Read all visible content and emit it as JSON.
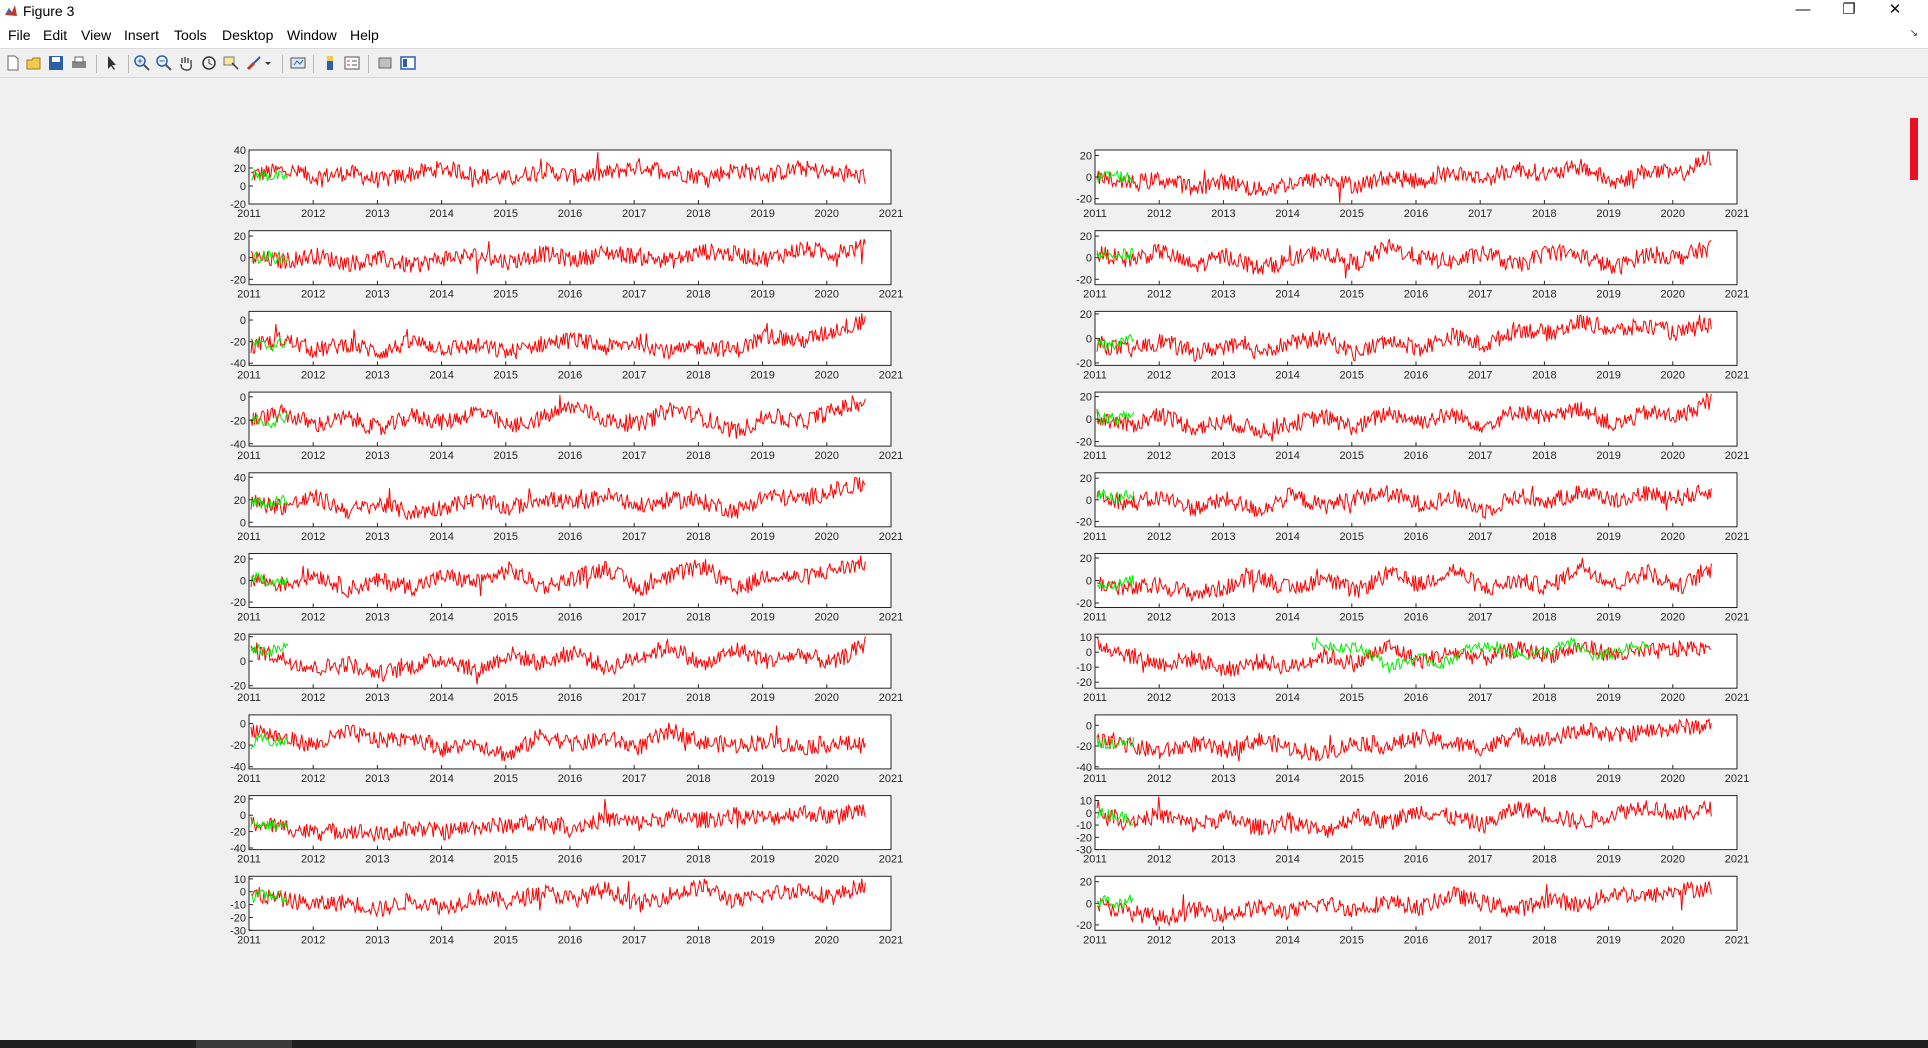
{
  "window": {
    "title": "Figure 3",
    "minimize_glyph": "—",
    "maximize_glyph": "❐",
    "close_glyph": "✕"
  },
  "menu": [
    "File",
    "Edit",
    "View",
    "Insert",
    "Tools",
    "Desktop",
    "Window",
    "Help"
  ],
  "toolbar_icons": [
    "new-figure-icon",
    "open-file-icon",
    "save-icon",
    "print-icon",
    "edit-plot-arrow-icon",
    "zoom-in-icon",
    "zoom-out-icon",
    "pan-hand-icon",
    "rotate-3d-icon",
    "data-cursor-icon",
    "brush-icon",
    "link-plot-icon",
    "colorbar-icon",
    "legend-icon",
    "hide-plot-tools-icon",
    "show-plot-tools-icon"
  ],
  "colors": {
    "series_primary": "#ff0000",
    "series_highlight": "#00ee00",
    "axes_bg": "#ffffff",
    "figure_bg": "#f0f0f0"
  },
  "chart_data": [
    {
      "type": "line",
      "position": "left-1",
      "x_ticks": [
        "2011",
        "2012",
        "2013",
        "2014",
        "2015",
        "2016",
        "2017",
        "2018",
        "2019",
        "2020",
        "2021"
      ],
      "y_ticks": [
        "40",
        "20",
        "0",
        "-20"
      ],
      "ylim": [
        -20,
        40
      ],
      "series": [
        {
          "color": "red",
          "values": [
            12,
            18,
            10,
            15,
            6,
            14,
            20,
            12,
            8,
            18,
            10,
            14,
            22,
            16,
            10,
            18,
            12,
            20,
            14,
            10
          ]
        },
        {
          "color": "green",
          "values": [
            12,
            11,
            10
          ]
        }
      ]
    },
    {
      "type": "line",
      "position": "left-2",
      "x_ticks": [
        "2011",
        "2012",
        "2013",
        "2014",
        "2015",
        "2016",
        "2017",
        "2018",
        "2019",
        "2020",
        "2021"
      ],
      "y_ticks": [
        "20",
        "0",
        "-20"
      ],
      "ylim": [
        -25,
        25
      ],
      "series": [
        {
          "color": "red",
          "values": [
            0,
            -3,
            2,
            -5,
            -1,
            -8,
            0,
            2,
            -4,
            4,
            -2,
            5,
            1,
            -3,
            6,
            3,
            -1,
            8,
            4,
            10
          ]
        },
        {
          "color": "green",
          "values": [
            0,
            1,
            -1
          ]
        }
      ]
    },
    {
      "type": "line",
      "position": "left-3",
      "x_ticks": [
        "2011",
        "2012",
        "2013",
        "2014",
        "2015",
        "2016",
        "2017",
        "2018",
        "2019",
        "2020",
        "2021"
      ],
      "y_ticks": [
        "0",
        "-20",
        "-40"
      ],
      "ylim": [
        -42,
        8
      ],
      "series": [
        {
          "color": "red",
          "values": [
            -25,
            -18,
            -28,
            -22,
            -30,
            -20,
            -26,
            -24,
            -30,
            -22,
            -18,
            -26,
            -20,
            -30,
            -24,
            -28,
            -14,
            -20,
            -10,
            0
          ]
        },
        {
          "color": "green",
          "values": [
            -22,
            -24,
            -20
          ]
        }
      ]
    },
    {
      "type": "line",
      "position": "left-4",
      "x_ticks": [
        "2011",
        "2012",
        "2013",
        "2014",
        "2015",
        "2016",
        "2017",
        "2018",
        "2019",
        "2020",
        "2021"
      ],
      "y_ticks": [
        "0",
        "-20",
        "-40"
      ],
      "ylim": [
        -42,
        4
      ],
      "series": [
        {
          "color": "red",
          "values": [
            -20,
            -14,
            -24,
            -18,
            -28,
            -16,
            -22,
            -12,
            -26,
            -18,
            -8,
            -20,
            -24,
            -10,
            -18,
            -30,
            -16,
            -22,
            -12,
            -4
          ]
        },
        {
          "color": "green",
          "values": [
            -18,
            -22,
            -16
          ]
        }
      ]
    },
    {
      "type": "line",
      "position": "left-5",
      "x_ticks": [
        "2011",
        "2012",
        "2013",
        "2014",
        "2015",
        "2016",
        "2017",
        "2018",
        "2019",
        "2020",
        "2021"
      ],
      "y_ticks": [
        "40",
        "20",
        "0"
      ],
      "ylim": [
        -4,
        44
      ],
      "series": [
        {
          "color": "red",
          "values": [
            18,
            14,
            22,
            10,
            16,
            8,
            14,
            20,
            12,
            22,
            16,
            24,
            14,
            20,
            18,
            10,
            24,
            20,
            28,
            34
          ]
        },
        {
          "color": "green",
          "values": [
            18,
            16,
            20
          ]
        }
      ]
    },
    {
      "type": "line",
      "position": "left-6",
      "x_ticks": [
        "2011",
        "2012",
        "2013",
        "2014",
        "2015",
        "2016",
        "2017",
        "2018",
        "2019",
        "2020",
        "2021"
      ],
      "y_ticks": [
        "20",
        "0",
        "-20"
      ],
      "ylim": [
        -25,
        25
      ],
      "series": [
        {
          "color": "red",
          "values": [
            2,
            -4,
            6,
            -8,
            0,
            -6,
            4,
            -2,
            10,
            -6,
            2,
            12,
            -8,
            4,
            14,
            -10,
            6,
            2,
            10,
            16
          ]
        },
        {
          "color": "green",
          "values": [
            2,
            0,
            -2
          ]
        }
      ]
    },
    {
      "type": "line",
      "position": "left-7",
      "x_ticks": [
        "2011",
        "2012",
        "2013",
        "2014",
        "2015",
        "2016",
        "2017",
        "2018",
        "2019",
        "2020",
        "2021"
      ],
      "y_ticks": [
        "20",
        "0",
        "-20"
      ],
      "ylim": [
        -22,
        22
      ],
      "series": [
        {
          "color": "red",
          "values": [
            10,
            2,
            -6,
            -2,
            -10,
            -4,
            2,
            -8,
            6,
            -2,
            8,
            -6,
            4,
            12,
            -4,
            10,
            0,
            6,
            -2,
            14
          ]
        },
        {
          "color": "green",
          "values": [
            10,
            8,
            12
          ]
        }
      ]
    },
    {
      "type": "line",
      "position": "left-8",
      "x_ticks": [
        "2011",
        "2012",
        "2013",
        "2014",
        "2015",
        "2016",
        "2017",
        "2018",
        "2019",
        "2020",
        "2021"
      ],
      "y_ticks": [
        "0",
        "-20",
        "-40"
      ],
      "ylim": [
        -42,
        8
      ],
      "series": [
        {
          "color": "red",
          "values": [
            -4,
            -14,
            -20,
            -8,
            -16,
            -12,
            -24,
            -18,
            -30,
            -10,
            -20,
            -14,
            -22,
            -6,
            -18,
            -20,
            -16,
            -22,
            -18,
            -20
          ]
        },
        {
          "color": "green",
          "values": [
            -20,
            -14,
            -18,
            -16
          ]
        }
      ]
    },
    {
      "type": "line",
      "position": "left-9",
      "x_ticks": [
        "2011",
        "2012",
        "2013",
        "2014",
        "2015",
        "2016",
        "2017",
        "2018",
        "2019",
        "2020",
        "2021"
      ],
      "y_ticks": [
        "20",
        "0",
        "-20",
        "-40"
      ],
      "ylim": [
        -42,
        24
      ],
      "series": [
        {
          "color": "red",
          "values": [
            -10,
            -14,
            -22,
            -18,
            -24,
            -16,
            -20,
            -14,
            -12,
            -8,
            -14,
            -4,
            -10,
            -2,
            -6,
            0,
            -4,
            4,
            -2,
            8
          ]
        },
        {
          "color": "green",
          "values": [
            -10,
            -12,
            -14
          ]
        }
      ]
    },
    {
      "type": "line",
      "position": "left-10",
      "x_ticks": [
        "2011",
        "2012",
        "2013",
        "2014",
        "2015",
        "2016",
        "2017",
        "2018",
        "2019",
        "2020",
        "2021"
      ],
      "y_ticks": [
        "10",
        "0",
        "-10",
        "-20",
        "-30"
      ],
      "ylim": [
        -30,
        12
      ],
      "series": [
        {
          "color": "red",
          "values": [
            -2,
            -6,
            -10,
            -8,
            -14,
            -6,
            -12,
            -4,
            -8,
            0,
            -6,
            2,
            -10,
            -2,
            4,
            -8,
            -2,
            2,
            -4,
            6
          ]
        },
        {
          "color": "green",
          "values": [
            -4,
            -2,
            -6
          ]
        }
      ]
    },
    {
      "type": "line",
      "position": "right-1",
      "x_ticks": [
        "2011",
        "2012",
        "2013",
        "2014",
        "2015",
        "2016",
        "2017",
        "2018",
        "2019",
        "2020",
        "2021"
      ],
      "y_ticks": [
        "20",
        "0",
        "-20"
      ],
      "ylim": [
        -25,
        25
      ],
      "series": [
        {
          "color": "red",
          "values": [
            0,
            -6,
            -2,
            -10,
            -4,
            -12,
            -6,
            -2,
            -8,
            0,
            -4,
            4,
            -2,
            8,
            2,
            10,
            -6,
            6,
            2,
            18
          ]
        },
        {
          "color": "green",
          "values": [
            0,
            2,
            -2
          ]
        }
      ]
    },
    {
      "type": "line",
      "position": "right-2",
      "x_ticks": [
        "2011",
        "2012",
        "2013",
        "2014",
        "2015",
        "2016",
        "2017",
        "2018",
        "2019",
        "2020",
        "2021"
      ],
      "y_ticks": [
        "20",
        "0",
        "-20"
      ],
      "ylim": [
        -25,
        25
      ],
      "series": [
        {
          "color": "red",
          "values": [
            4,
            -2,
            6,
            -8,
            2,
            -10,
            -2,
            6,
            -6,
            10,
            0,
            -4,
            4,
            -8,
            6,
            2,
            -10,
            4,
            0,
            10
          ]
        },
        {
          "color": "green",
          "values": [
            4,
            0,
            6
          ]
        }
      ]
    },
    {
      "type": "line",
      "position": "right-3",
      "x_ticks": [
        "2011",
        "2012",
        "2013",
        "2014",
        "2015",
        "2016",
        "2017",
        "2018",
        "2019",
        "2020",
        "2021"
      ],
      "y_ticks": [
        "20",
        "0",
        "-20"
      ],
      "ylim": [
        -22,
        22
      ],
      "series": [
        {
          "color": "red",
          "values": [
            -4,
            -10,
            -2,
            -12,
            -6,
            -10,
            -4,
            0,
            -12,
            -2,
            -8,
            2,
            -6,
            8,
            4,
            14,
            6,
            10,
            4,
            12
          ]
        },
        {
          "color": "green",
          "values": [
            -4,
            -6,
            -2,
            0
          ]
        }
      ]
    },
    {
      "type": "line",
      "position": "right-4",
      "x_ticks": [
        "2011",
        "2012",
        "2013",
        "2014",
        "2015",
        "2016",
        "2017",
        "2018",
        "2019",
        "2020",
        "2021"
      ],
      "y_ticks": [
        "20",
        "0",
        "-20"
      ],
      "ylim": [
        -24,
        24
      ],
      "series": [
        {
          "color": "red",
          "values": [
            2,
            -6,
            4,
            -8,
            -2,
            -10,
            -4,
            2,
            -8,
            6,
            -2,
            4,
            -6,
            8,
            0,
            10,
            -6,
            6,
            2,
            16
          ]
        },
        {
          "color": "green",
          "values": [
            2,
            0,
            4
          ]
        }
      ]
    },
    {
      "type": "line",
      "position": "right-5",
      "x_ticks": [
        "2011",
        "2012",
        "2013",
        "2014",
        "2015",
        "2016",
        "2017",
        "2018",
        "2019",
        "2020",
        "2021"
      ],
      "y_ticks": [
        "20",
        "0",
        "-20"
      ],
      "ylim": [
        -25,
        25
      ],
      "series": [
        {
          "color": "red",
          "values": [
            6,
            -4,
            2,
            -8,
            0,
            -10,
            4,
            -6,
            2,
            6,
            -4,
            2,
            -10,
            4,
            -2,
            8,
            0,
            6,
            2,
            8
          ]
        },
        {
          "color": "green",
          "values": [
            6,
            2,
            4
          ]
        }
      ]
    },
    {
      "type": "line",
      "position": "right-6",
      "x_ticks": [
        "2011",
        "2012",
        "2013",
        "2014",
        "2015",
        "2016",
        "2017",
        "2018",
        "2019",
        "2020",
        "2021"
      ],
      "y_ticks": [
        "20",
        "0",
        "-20"
      ],
      "ylim": [
        -24,
        24
      ],
      "series": [
        {
          "color": "red",
          "values": [
            -2,
            -8,
            -4,
            -12,
            -6,
            4,
            -8,
            2,
            -10,
            6,
            -4,
            10,
            -8,
            0,
            -6,
            14,
            -4,
            8,
            -6,
            10
          ]
        },
        {
          "color": "green",
          "values": [
            -2,
            -4,
            0
          ]
        }
      ]
    },
    {
      "type": "line",
      "position": "right-7",
      "x_ticks": [
        "2011",
        "2012",
        "2013",
        "2014",
        "2015",
        "2016",
        "2017",
        "2018",
        "2019",
        "2020",
        "2021"
      ],
      "y_ticks": [
        "10",
        "0",
        "-10",
        "-20"
      ],
      "ylim": [
        -24,
        12
      ],
      "series": [
        {
          "color": "red",
          "values": [
            6,
            -2,
            -8,
            -4,
            -12,
            -6,
            -10,
            -2,
            -8,
            4,
            -6,
            0,
            -4,
            2,
            -2,
            4,
            -2,
            0,
            2,
            4
          ]
        },
        {
          "color": "green",
          "values": [
            6,
            4,
            2,
            -10,
            -4,
            -8,
            2,
            4,
            -2,
            0,
            6,
            -4,
            2,
            4
          ]
        }
      ]
    },
    {
      "type": "line",
      "position": "right-8",
      "x_ticks": [
        "2011",
        "2012",
        "2013",
        "2014",
        "2015",
        "2016",
        "2017",
        "2018",
        "2019",
        "2020",
        "2021"
      ],
      "y_ticks": [
        "0",
        "-20",
        "-40"
      ],
      "ylim": [
        -42,
        10
      ],
      "series": [
        {
          "color": "red",
          "values": [
            -16,
            -20,
            -26,
            -18,
            -24,
            -14,
            -22,
            -28,
            -16,
            -20,
            -12,
            -18,
            -22,
            -10,
            -14,
            -4,
            -10,
            -6,
            -2,
            0
          ]
        },
        {
          "color": "green",
          "values": [
            -16,
            -18,
            -14
          ]
        }
      ]
    },
    {
      "type": "line",
      "position": "right-9",
      "x_ticks": [
        "2011",
        "2012",
        "2013",
        "2014",
        "2015",
        "2016",
        "2017",
        "2018",
        "2019",
        "2020",
        "2021"
      ],
      "y_ticks": [
        "10",
        "0",
        "-10",
        "-20",
        "-30"
      ],
      "ylim": [
        -30,
        14
      ],
      "series": [
        {
          "color": "red",
          "values": [
            0,
            -6,
            -2,
            -10,
            -4,
            -12,
            -6,
            -16,
            -2,
            -8,
            2,
            -4,
            -10,
            4,
            -2,
            -8,
            0,
            6,
            -2,
            4
          ]
        },
        {
          "color": "green",
          "values": [
            0,
            -2,
            -6
          ]
        }
      ]
    },
    {
      "type": "line",
      "position": "right-10",
      "x_ticks": [
        "2011",
        "2012",
        "2013",
        "2014",
        "2015",
        "2016",
        "2017",
        "2018",
        "2019",
        "2020",
        "2021"
      ],
      "y_ticks": [
        "20",
        "0",
        "-20"
      ],
      "ylim": [
        -25,
        25
      ],
      "series": [
        {
          "color": "red",
          "values": [
            -2,
            -8,
            -14,
            -6,
            -10,
            -4,
            -8,
            0,
            -6,
            2,
            -4,
            8,
            0,
            -6,
            4,
            -2,
            10,
            6,
            12,
            14
          ]
        },
        {
          "color": "green",
          "values": [
            -2,
            4,
            -4,
            2,
            8
          ]
        }
      ]
    }
  ]
}
